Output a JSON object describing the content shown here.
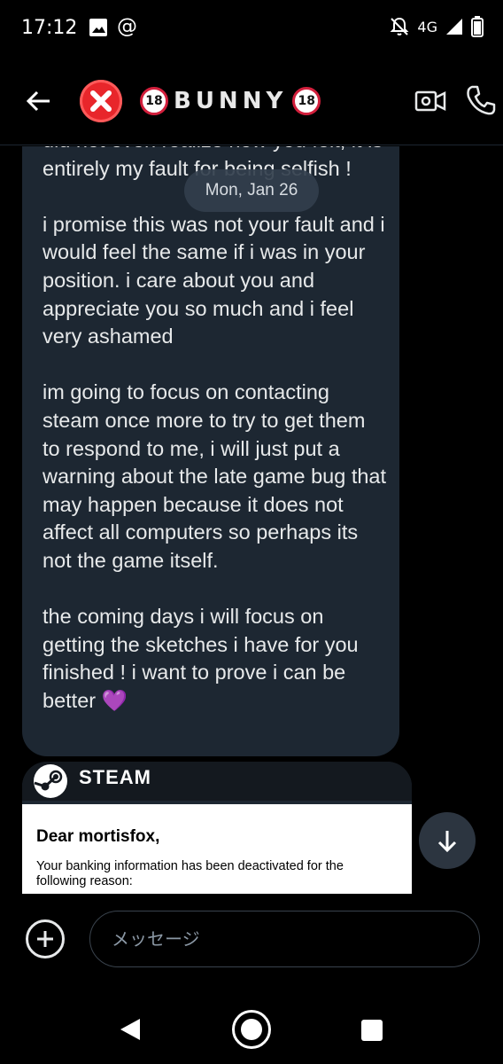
{
  "status_bar": {
    "time": "17:12",
    "network": "4G",
    "icons": [
      "image-icon",
      "at-icon",
      "muted-bell-icon",
      "signal-icon",
      "battery-icon"
    ]
  },
  "header": {
    "avatar_icon": "red-cross-mark-icon",
    "badge_left": "18",
    "name": "BUNNY",
    "badge_right": "18"
  },
  "date_chip": "Mon, Jan 26",
  "message": {
    "paragraphs": [
      "did not even realize how you felt, it is entirely my fault for being selfish !",
      "i promise this was not your fault and i would feel the same if i was in your position. i care about you and appreciate you so much and i feel very ashamed",
      "im going to focus on contacting steam once more to try to get them to respond to me, i will just put a warning about the late game bug that may happen because it does not affect all computers so perhaps its not the game itself.",
      "the coming days i will focus on getting the sketches i have for you finished ! i want to prove i can be better"
    ],
    "emoji": "💜",
    "bubble_color": "#1d2732"
  },
  "shared_card": {
    "brand": "STEAM",
    "greeting": "Dear mortisfox,",
    "body": "Your banking information has been deactivated for the following reason:"
  },
  "composer": {
    "placeholder": "メッセージ"
  },
  "colors": {
    "background": "#000000",
    "text": "#e7e9ea",
    "heart": "#8a2be2",
    "avatar": "#e8262b",
    "badge_ring": "#d21f3c"
  }
}
